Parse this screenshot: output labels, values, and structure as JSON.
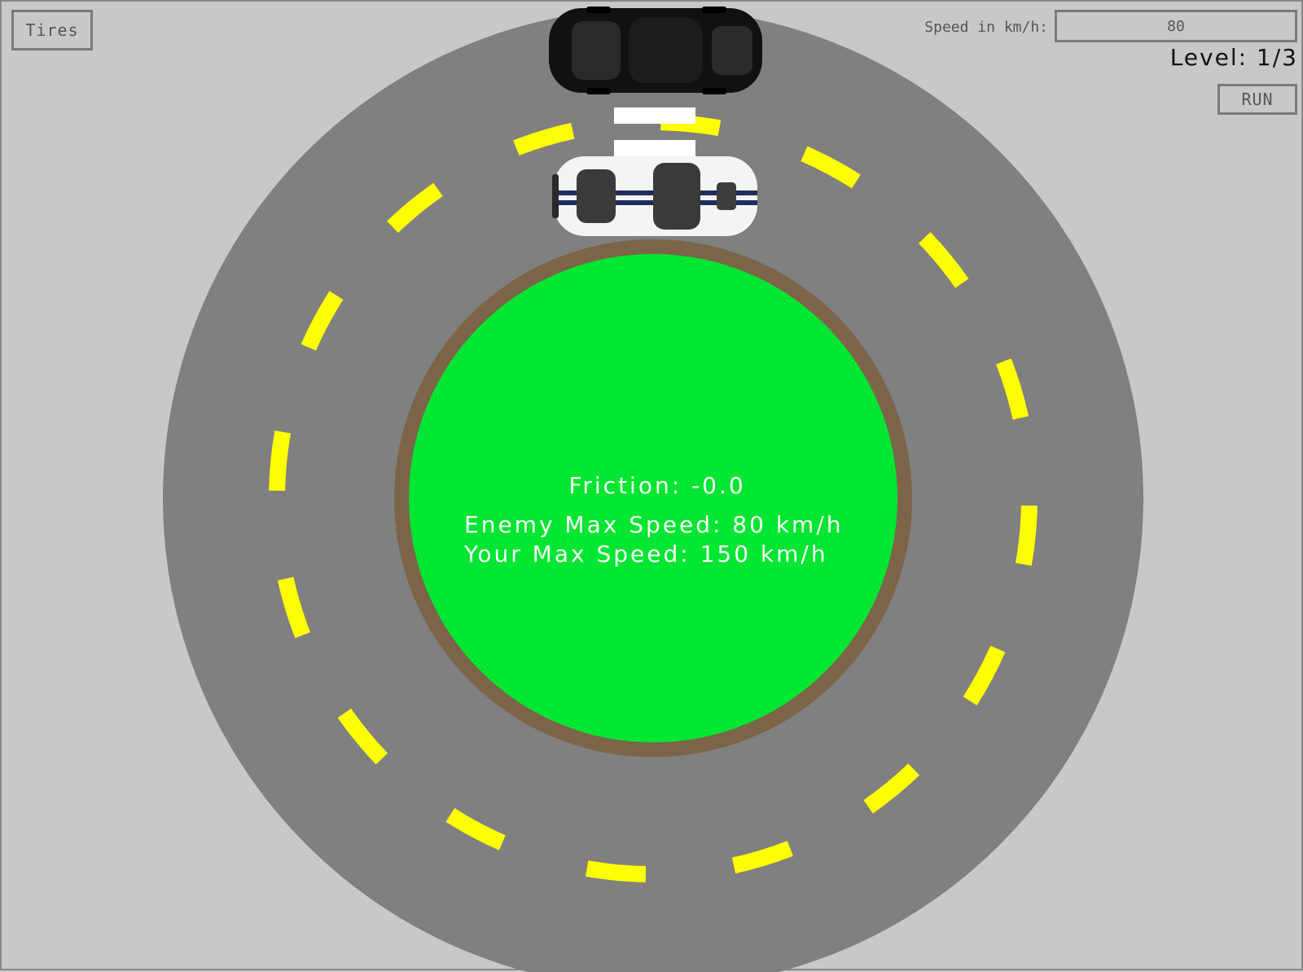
{
  "controls": {
    "tires_label": "Tires",
    "speed_label": "Speed in km/h:",
    "speed_value": "80",
    "run_label": "RUN"
  },
  "hud": {
    "level_text": "Level: 1/3"
  },
  "info": {
    "friction_text": "Friction: -0.0",
    "enemy_text": "Enemy Max Speed: 80 km/h",
    "player_text": "Your Max Speed: 150 km/h"
  },
  "colors": {
    "background": "#c8c8c8",
    "road": "#808080",
    "lane_marking": "#ffff00",
    "grass": "#00e632",
    "dirt_ring": "#7c6448",
    "start_line": "#ffffff",
    "enemy_car": "#101010",
    "player_car": "#f4f4f4",
    "player_stripe": "#1e2d5a"
  },
  "track": {
    "lane_dashes": 16
  }
}
